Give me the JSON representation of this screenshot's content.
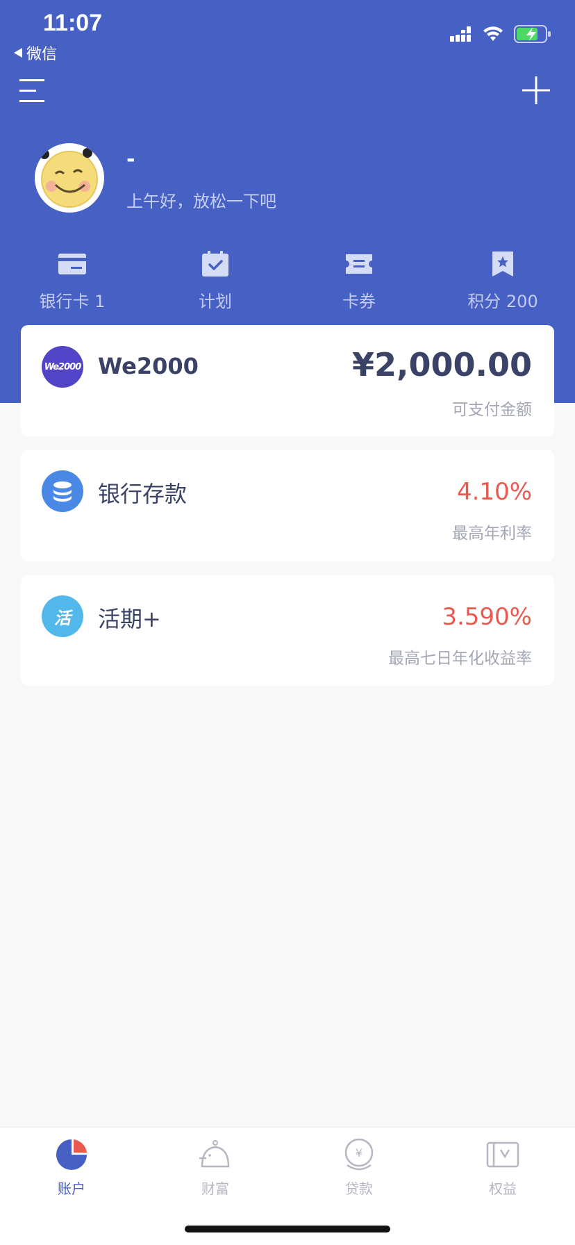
{
  "status_bar": {
    "time": "11:07",
    "back_label": "微信"
  },
  "profile": {
    "name": "-",
    "greeting": "上午好，放松一下吧"
  },
  "quick_actions": [
    {
      "label": "银行卡 1",
      "icon": "bank-card-icon"
    },
    {
      "label": "计划",
      "icon": "calendar-check-icon"
    },
    {
      "label": "卡券",
      "icon": "coupon-icon"
    },
    {
      "label": "积分 200",
      "icon": "points-badge-icon"
    }
  ],
  "cards": {
    "we2000": {
      "logo_text": "We2000",
      "name": "We2000",
      "value": "¥2,000.00",
      "sub": "可支付金额"
    },
    "deposit": {
      "name": "银行存款",
      "value": "4.10%",
      "sub": "最高年利率"
    },
    "current": {
      "logo_text": "活",
      "name": "活期+",
      "value": "3.590%",
      "sub": "最高七日年化收益率"
    }
  },
  "tabs": [
    {
      "label": "账户",
      "icon": "pie-chart-icon",
      "active": true
    },
    {
      "label": "财富",
      "icon": "piggy-bank-icon",
      "active": false
    },
    {
      "label": "贷款",
      "icon": "yen-coin-icon",
      "active": false
    },
    {
      "label": "权益",
      "icon": "voucher-icon",
      "active": false
    }
  ],
  "colors": {
    "header_bg": "#4760c4",
    "accent": "#4760c4",
    "rate_red": "#e85a4f",
    "text_dark": "#3a4266",
    "text_muted": "#a3a6b4"
  }
}
